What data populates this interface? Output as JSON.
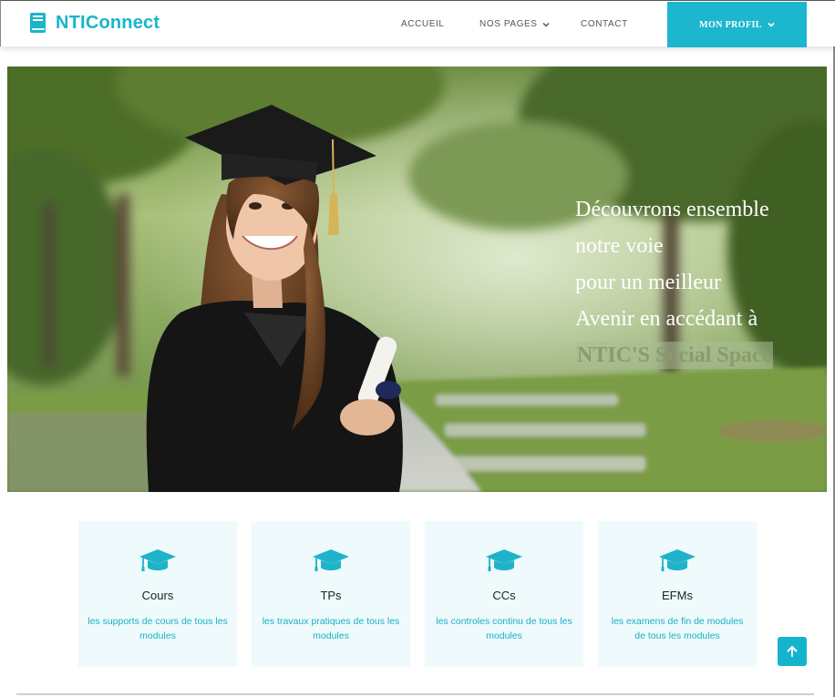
{
  "brand": {
    "name": "NTIConnect",
    "icon": "book-icon",
    "color": "#19b5c8"
  },
  "nav": {
    "home": "ACCUEIL",
    "pages": "NOS PAGES",
    "contact": "CONTACT",
    "profile": "MON PROFIL"
  },
  "hero": {
    "lines": [
      "Découvrons ensemble",
      "notre voie",
      "pour un meilleur",
      "Avenir en accédant à"
    ],
    "highlight": "NTIC'S Social Space"
  },
  "cards": [
    {
      "title": "Cours",
      "desc": "les supports de cours de tous les modules",
      "icon": "graduation-cap-icon"
    },
    {
      "title": "TPs",
      "desc": "les travaux pratiques de tous les modules",
      "icon": "graduation-cap-icon"
    },
    {
      "title": "CCs",
      "desc": "les controles continu de tous les modules",
      "icon": "graduation-cap-icon"
    },
    {
      "title": "EFMs",
      "desc": "les examens de fin de modules de tous les modules",
      "icon": "graduation-cap-icon"
    }
  ],
  "accent": "#1cb6cf",
  "back_to_top_icon": "arrow-up-icon"
}
